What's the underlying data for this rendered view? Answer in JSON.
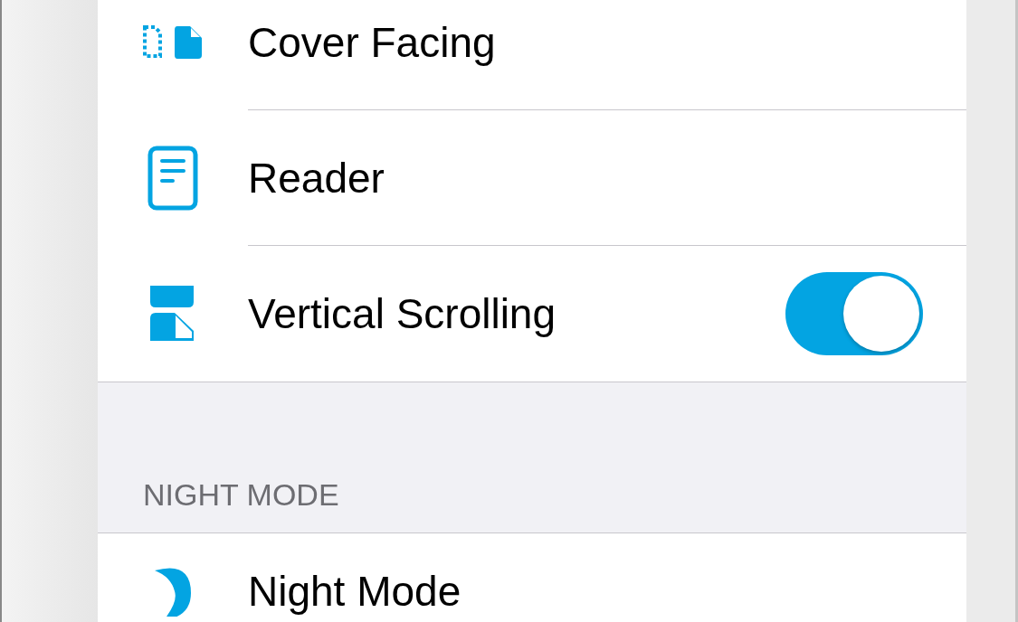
{
  "sections": [
    {
      "rows": [
        {
          "label": "Cover Facing",
          "kind": "plain"
        },
        {
          "label": "Reader",
          "kind": "plain"
        },
        {
          "label": "Vertical Scrolling",
          "kind": "toggle",
          "on": true
        }
      ]
    },
    {
      "header": "NIGHT MODE",
      "rows": [
        {
          "label": "Night Mode",
          "kind": "plain"
        }
      ]
    }
  ]
}
